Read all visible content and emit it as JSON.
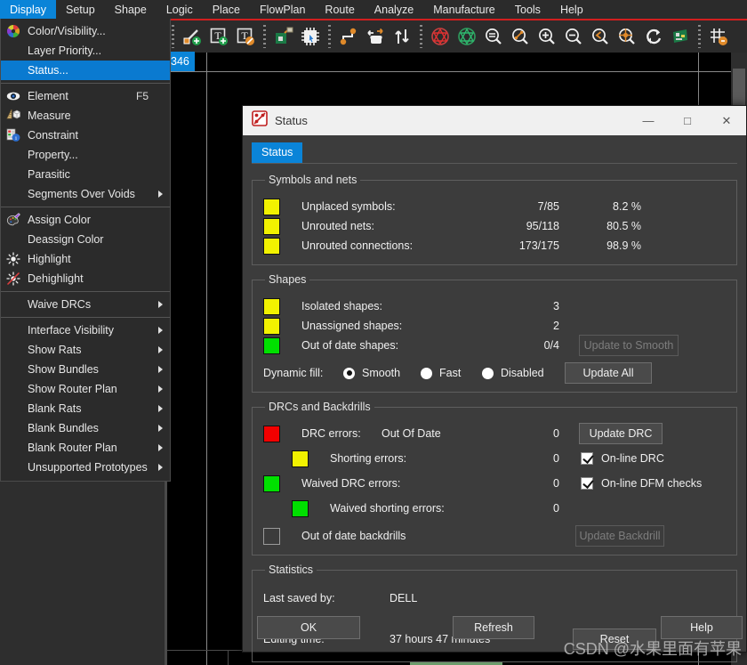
{
  "menubar": {
    "items": [
      {
        "label": "Display",
        "active": true
      },
      {
        "label": "Setup",
        "active": false
      },
      {
        "label": "Shape",
        "active": false
      },
      {
        "label": "Logic",
        "active": false
      },
      {
        "label": "Place",
        "active": false
      },
      {
        "label": "FlowPlan",
        "active": false
      },
      {
        "label": "Route",
        "active": false
      },
      {
        "label": "Analyze",
        "active": false
      },
      {
        "label": "Manufacture",
        "active": false
      },
      {
        "label": "Tools",
        "active": false
      },
      {
        "label": "Help",
        "active": false
      }
    ]
  },
  "toolbar": {
    "icons": [
      "add-line-icon",
      "add-text-icon",
      "delete-text-icon",
      "add-component-icon",
      "place-chip-icon",
      "add-connect-icon",
      "slide-icon",
      "swap-icon",
      "rats-nest-red-icon",
      "rats-nest-green-icon",
      "zoom-fit-icon",
      "zoom-by-points-icon",
      "zoom-in-icon",
      "zoom-out-icon",
      "zoom-previous-icon",
      "zoom-center-icon",
      "redraw-icon",
      "board-icon",
      "grid-toggle-icon"
    ]
  },
  "canvas": {
    "tab_chip_label": "346"
  },
  "dropdown": {
    "items": [
      {
        "label": "Color/Visibility...",
        "icon": "color-wheel-icon",
        "shortcut": "",
        "submenu": false,
        "selected": false
      },
      {
        "label": "Layer Priority...",
        "icon": "",
        "shortcut": "",
        "submenu": false,
        "selected": false
      },
      {
        "separator_after": true,
        "label": "Status...",
        "icon": "",
        "shortcut": "",
        "submenu": false,
        "selected": true
      },
      {
        "label": "Element",
        "icon": "eye-icon",
        "shortcut": "F5",
        "submenu": false,
        "selected": false
      },
      {
        "label": "Measure",
        "icon": "measure-icon",
        "shortcut": "",
        "submenu": false,
        "selected": false
      },
      {
        "label": "Constraint",
        "icon": "constraint-icon",
        "shortcut": "",
        "submenu": false,
        "selected": false
      },
      {
        "label": "Property...",
        "icon": "",
        "shortcut": "",
        "submenu": false,
        "selected": false
      },
      {
        "label": "Parasitic",
        "icon": "",
        "shortcut": "",
        "submenu": false,
        "selected": false
      },
      {
        "label": "Segments Over Voids",
        "icon": "",
        "shortcut": "",
        "submenu": true,
        "selected": false
      },
      {
        "label": "Assign Color",
        "icon": "palette-icon",
        "shortcut": "",
        "submenu": false,
        "selected": false
      },
      {
        "label": "Deassign Color",
        "icon": "",
        "shortcut": "",
        "submenu": false,
        "selected": false
      },
      {
        "label": "Highlight",
        "icon": "highlight-icon",
        "shortcut": "",
        "submenu": false,
        "selected": false
      },
      {
        "label": "Dehighlight",
        "icon": "dehighlight-icon",
        "shortcut": "",
        "submenu": false,
        "selected": false
      },
      {
        "label": "Waive DRCs",
        "icon": "",
        "shortcut": "",
        "submenu": true,
        "selected": false
      },
      {
        "label": "Interface Visibility",
        "icon": "",
        "shortcut": "",
        "submenu": true,
        "selected": false
      },
      {
        "label": "Show Rats",
        "icon": "",
        "shortcut": "",
        "submenu": true,
        "selected": false
      },
      {
        "label": "Show Bundles",
        "icon": "",
        "shortcut": "",
        "submenu": true,
        "selected": false
      },
      {
        "label": "Show Router Plan",
        "icon": "",
        "shortcut": "",
        "submenu": true,
        "selected": false
      },
      {
        "label": "Blank Rats",
        "icon": "",
        "shortcut": "",
        "submenu": true,
        "selected": false
      },
      {
        "label": "Blank Bundles",
        "icon": "",
        "shortcut": "",
        "submenu": true,
        "selected": false
      },
      {
        "label": "Blank Router Plan",
        "icon": "",
        "shortcut": "",
        "submenu": true,
        "selected": false
      },
      {
        "label": "Unsupported Prototypes",
        "icon": "",
        "shortcut": "",
        "submenu": true,
        "selected": false
      }
    ]
  },
  "dialog": {
    "title": "Status",
    "window_buttons": {
      "minimize": "—",
      "maximize": "□",
      "close": "✕"
    },
    "tab_label": "Status",
    "symbols_and_nets": {
      "legend": "Symbols and nets",
      "rows": [
        {
          "color": "#f2f200",
          "label": "Unplaced symbols:",
          "value": "7/85",
          "percent": "8.2 %"
        },
        {
          "color": "#f2f200",
          "label": "Unrouted nets:",
          "value": "95/118",
          "percent": "80.5 %"
        },
        {
          "color": "#f2f200",
          "label": "Unrouted connections:",
          "value": "173/175",
          "percent": "98.9 %"
        }
      ]
    },
    "shapes": {
      "legend": "Shapes",
      "rows": [
        {
          "color": "#f2f200",
          "label": "Isolated shapes:",
          "value": "3"
        },
        {
          "color": "#f2f200",
          "label": "Unassigned shapes:",
          "value": "2"
        },
        {
          "color": "#00e000",
          "label": "Out of date shapes:",
          "value": "0/4"
        }
      ],
      "update_to_smooth_label": "Update to Smooth",
      "dynamic_fill_label": "Dynamic fill:",
      "dynamic_fill_options": [
        {
          "label": "Smooth",
          "selected": true
        },
        {
          "label": "Fast",
          "selected": false
        },
        {
          "label": "Disabled",
          "selected": false
        }
      ],
      "update_all_label": "Update All"
    },
    "drcs": {
      "legend": "DRCs and Backdrills",
      "drc_errors_label": "DRC errors:",
      "drc_errors_state": "Out Of Date",
      "drc_errors_value": "0",
      "update_drc_label": "Update DRC",
      "shorting_errors_label": "Shorting errors:",
      "shorting_errors_value": "0",
      "online_drc_label": "On-line DRC",
      "online_drc_checked": true,
      "waived_drc_label": "Waived DRC errors:",
      "waived_drc_value": "0",
      "online_dfm_label": "On-line DFM checks",
      "online_dfm_checked": true,
      "waived_shorting_label": "Waived shorting errors:",
      "waived_shorting_value": "0",
      "out_of_date_backdrills_label": "Out of date backdrills",
      "update_backdrill_label": "Update Backdrill"
    },
    "statistics": {
      "legend": "Statistics",
      "last_saved_by_label": "Last saved by:",
      "last_saved_by_value": "DELL",
      "editing_time_label": "Editing time:",
      "editing_time_value": "37 hours 47 minutes",
      "reset_label": "Reset"
    },
    "footer": {
      "ok_label": "OK",
      "refresh_label": "Refresh",
      "help_label": "Help"
    }
  },
  "watermark": "CSDN @水果里面有苹果",
  "colors": {
    "accent_blue": "#0a84d8",
    "red_rule": "#d21f1f",
    "yellow": "#f2f200",
    "green": "#00e000",
    "red": "#f20000"
  }
}
